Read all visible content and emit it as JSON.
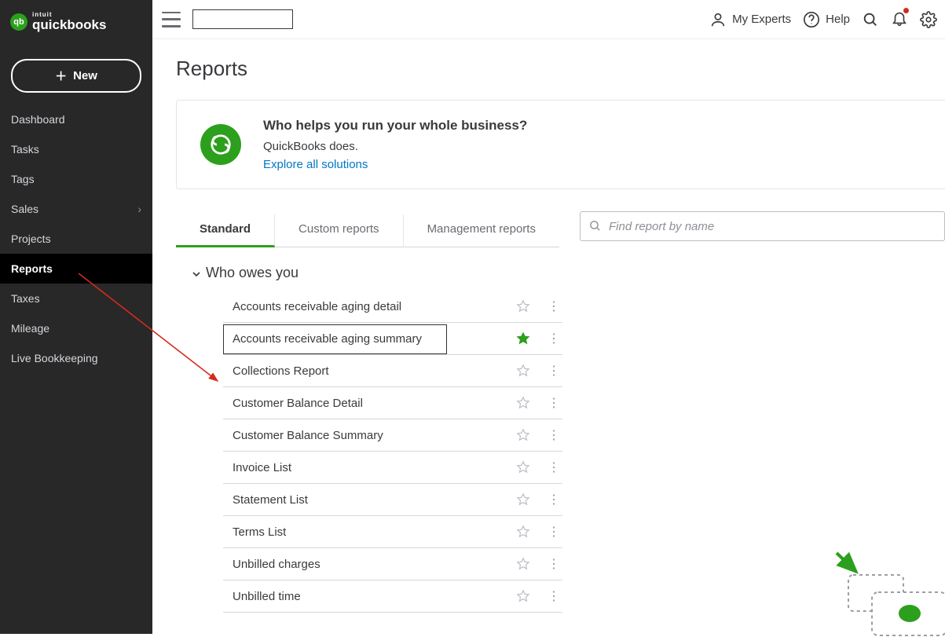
{
  "brand": {
    "intuit": "intuit",
    "name": "quickbooks",
    "mark": "qb"
  },
  "sidebar": {
    "new_label": "New",
    "items": [
      {
        "label": "Dashboard"
      },
      {
        "label": "Tasks"
      },
      {
        "label": "Tags"
      },
      {
        "label": "Sales",
        "has_sub": true
      },
      {
        "label": "Projects"
      },
      {
        "label": "Reports",
        "active": true
      },
      {
        "label": "Taxes"
      },
      {
        "label": "Mileage"
      },
      {
        "label": "Live Bookkeeping"
      }
    ]
  },
  "topbar": {
    "experts": "My Experts",
    "help": "Help"
  },
  "page": {
    "title": "Reports"
  },
  "promo": {
    "heading": "Who helps you run your whole business?",
    "sub": "QuickBooks does.",
    "link": "Explore all solutions"
  },
  "tabs": [
    {
      "label": "Standard",
      "active": true
    },
    {
      "label": "Custom reports"
    },
    {
      "label": "Management reports"
    }
  ],
  "search": {
    "placeholder": "Find report by name"
  },
  "section": {
    "title": "Who owes you",
    "reports": [
      {
        "name": "Accounts receivable aging detail",
        "fav": false
      },
      {
        "name": "Accounts receivable aging summary",
        "fav": true,
        "boxed": true
      },
      {
        "name": "Collections Report",
        "fav": false
      },
      {
        "name": "Customer Balance Detail",
        "fav": false
      },
      {
        "name": "Customer Balance Summary",
        "fav": false
      },
      {
        "name": "Invoice List",
        "fav": false
      },
      {
        "name": "Statement List",
        "fav": false
      },
      {
        "name": "Terms List",
        "fav": false
      },
      {
        "name": "Unbilled charges",
        "fav": false
      },
      {
        "name": "Unbilled time",
        "fav": false
      }
    ]
  }
}
